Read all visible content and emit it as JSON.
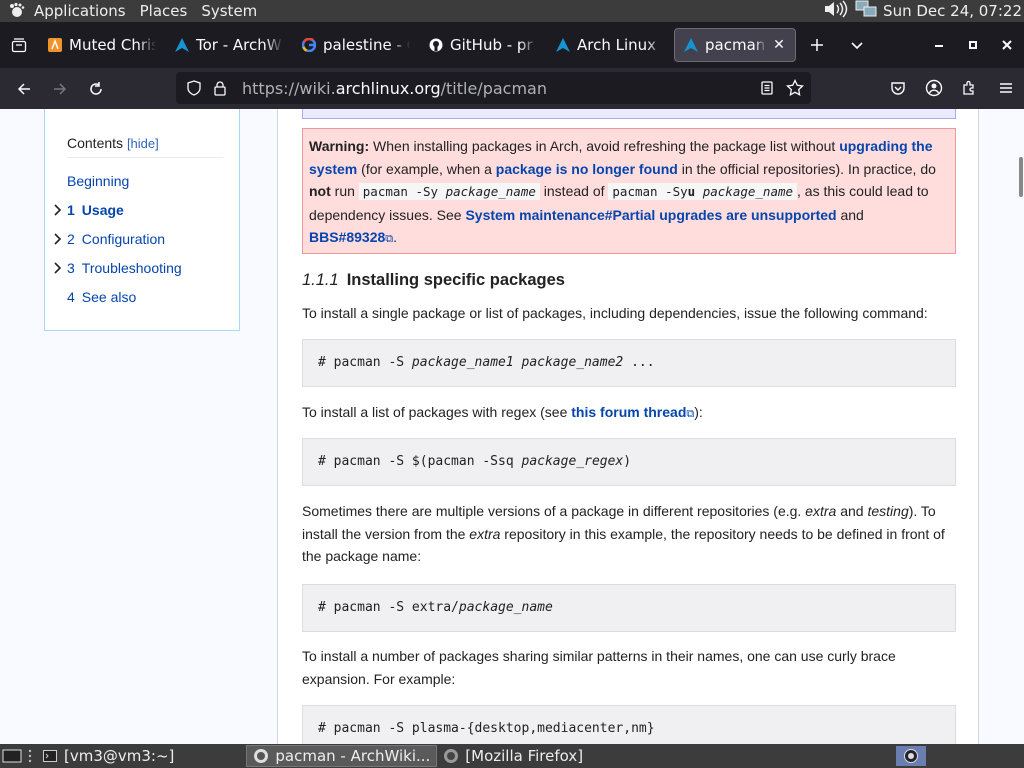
{
  "top_panel": {
    "menu": [
      "Applications",
      "Places",
      "System"
    ],
    "clock": "Sun Dec 24, 07:22"
  },
  "tabs": [
    {
      "title": "Muted Christmas",
      "favicon": "orange-app-icon",
      "active": false
    },
    {
      "title": "Tor - ArchWiki",
      "favicon": "arch-icon",
      "active": false
    },
    {
      "title": "palestine - Google",
      "favicon": "google-icon",
      "active": false
    },
    {
      "title": "GitHub - pr",
      "favicon": "github-icon",
      "active": false
    },
    {
      "title": "Arch Linux",
      "favicon": "arch-icon",
      "active": false
    },
    {
      "title": "pacman - ArchWiki",
      "favicon": "arch-icon",
      "active": true
    }
  ],
  "navbar": {
    "url_prefix": "https://wiki.",
    "url_host": "archlinux.org",
    "url_path": "/title/pacman"
  },
  "toc": {
    "title": "Contents",
    "hide_label": "[hide]",
    "items": [
      {
        "num": "",
        "label": "Beginning"
      },
      {
        "num": "1",
        "label": "Usage",
        "selected": true
      },
      {
        "num": "2",
        "label": "Configuration"
      },
      {
        "num": "3",
        "label": "Troubleshooting"
      },
      {
        "num": "4",
        "label": "See also"
      }
    ]
  },
  "warning": {
    "label": "Warning:",
    "t1": " When installing packages in Arch, avoid refreshing the package list without ",
    "link1": "upgrading the system",
    "t2": " (for example, when a ",
    "link2": "package is no longer found",
    "t3": " in the official repositories). In practice, do ",
    "not": "not",
    "t4": " run ",
    "code1a": "pacman -Sy ",
    "code1b": "package_name",
    "t5": " instead of ",
    "code2a": "pacman -Sy",
    "code2u": "u",
    "code2b": " package_name",
    "t6": ", as this could lead to dependency issues. See ",
    "link3": "System maintenance#Partial upgrades are unsupported",
    "t7": " and ",
    "link4": "BBS#89328",
    "t8": "."
  },
  "section": {
    "num": "1.1.1",
    "title": "Installing specific packages"
  },
  "content": {
    "p1": "To install a single package or list of packages, including dependencies, issue the following command:",
    "pre1a": "# pacman -S ",
    "pre1b": "package_name1 package_name2",
    "pre1c": " ...",
    "p2a": "To install a list of packages with regex (see ",
    "p2link": "this forum thread",
    "p2b": "):",
    "pre2a": "# pacman -S $(pacman -Ssq ",
    "pre2b": "package_regex",
    "pre2c": ")",
    "p3a": "Sometimes there are multiple versions of a package in different repositories (e.g. ",
    "p3i1": "extra",
    "p3b": " and ",
    "p3i2": "testing",
    "p3c": "). To install the version from the ",
    "p3i3": "extra",
    "p3d": " repository in this example, the repository needs to be defined in front of the package name:",
    "pre3a": "# pacman -S extra/",
    "pre3b": "package_name",
    "p4": "To install a number of packages sharing similar patterns in their names, one can use curly brace expansion. For example:",
    "pre4": "# pacman -S plasma-{desktop,mediacenter,nm}"
  },
  "taskbar": {
    "tasks": [
      {
        "label": "[vm3@vm3:~]",
        "icon": "terminal-icon",
        "active": false
      },
      {
        "label": "pacman - ArchWiki...",
        "icon": "firefox-icon",
        "active": true
      },
      {
        "label": "[Mozilla Firefox]",
        "icon": "firefox-icon",
        "active": false
      }
    ]
  }
}
